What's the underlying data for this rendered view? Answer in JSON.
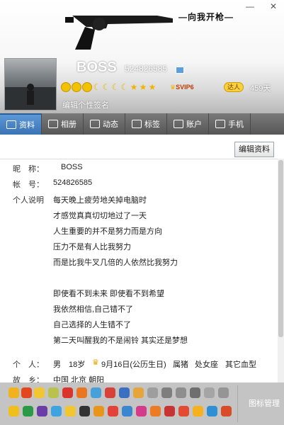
{
  "window": {
    "minimize": "—",
    "close": "✕"
  },
  "banner": {
    "slogan": "向我开枪"
  },
  "profile": {
    "nickname": "BOSS",
    "qq": "524826585",
    "signature": "编辑个性签名",
    "days": "459天",
    "svip": "SVIP6",
    "pet": "达人"
  },
  "tabs": [
    {
      "label": "资料",
      "icon": "card-icon"
    },
    {
      "label": "相册",
      "icon": "photo-icon"
    },
    {
      "label": "动态",
      "icon": "feed-icon"
    },
    {
      "label": "标签",
      "icon": "tag-icon"
    },
    {
      "label": "账户",
      "icon": "wallet-icon"
    },
    {
      "label": "手机",
      "icon": "phone-icon"
    }
  ],
  "edit_button": "编辑资料",
  "info": {
    "nick_label": "昵　称：",
    "nick_value": "BOSS",
    "account_label": "帐　号：",
    "account_value": "524826585",
    "desc_label": "个人说明",
    "desc_lines": [
      "每天晚上疲劳地关掉电脑时",
      "才感觉真真切切地过了一天",
      "人生重要的并不是努力而是方向",
      "压力不是有人比我努力",
      "而是比我牛叉几倍的人依然比我努力",
      "",
      "即使看不到未来 即使看不到希望",
      "我依然相信,自己错不了",
      "自己选择的人生错不了",
      "第二天叫醒我的不是闹铃 其实还是梦想"
    ],
    "person_label": "个　人：",
    "gender": "男",
    "age": "18岁",
    "birthday": "9月16日(公历生日)",
    "zodiac": "属猪",
    "star": "处女座",
    "blood": "其它血型",
    "hometown_label": "故　乡：",
    "hometown": "中国 北京 朝阳"
  },
  "manage": "图标管理",
  "colors": {
    "tab_active": "#4a86c8",
    "tab_bar": "#666666",
    "bottom": "#c4c4c4"
  }
}
